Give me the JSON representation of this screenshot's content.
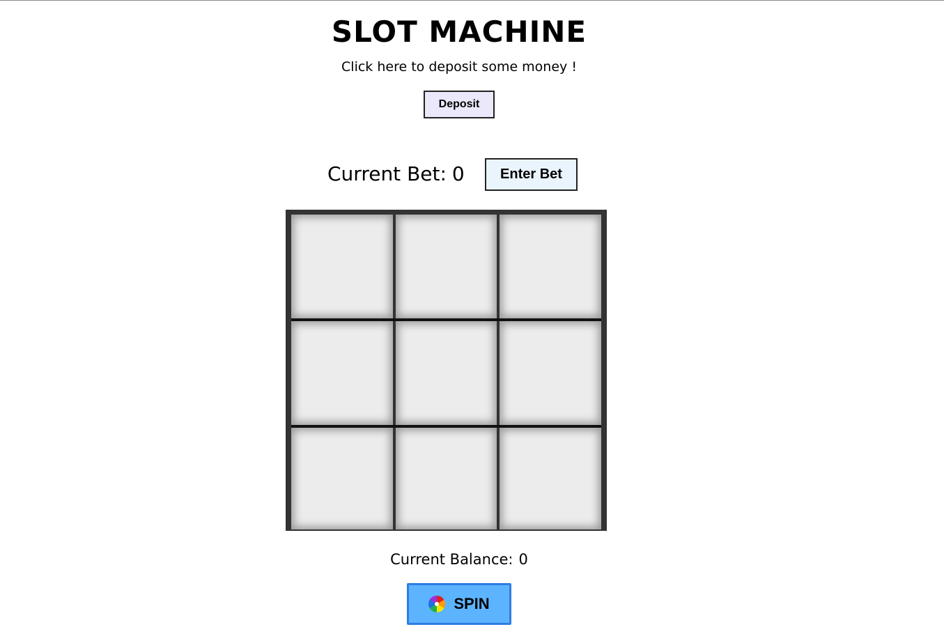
{
  "header": {
    "title": "SLOT MACHINE",
    "subtitle": "Click here to deposit some money !"
  },
  "deposit": {
    "button_label": "Deposit"
  },
  "bet": {
    "label": "Current Bet:",
    "value": "0",
    "button_label": "Enter Bet"
  },
  "reels": {
    "rows": [
      [
        "",
        "",
        ""
      ],
      [
        "",
        "",
        ""
      ],
      [
        "",
        "",
        ""
      ]
    ]
  },
  "balance": {
    "label": "Current Balance:",
    "value": "0"
  },
  "spin": {
    "button_label": "SPIN",
    "icon": "color-wheel-icon"
  },
  "colors": {
    "grid_frame": "#333333",
    "cell_bg": "#ececec",
    "spin_bg": "#5cb4ff",
    "spin_border": "#2f7de1",
    "deposit_bg": "#ece8fb",
    "enter_bet_bg": "#eaf4fd"
  }
}
